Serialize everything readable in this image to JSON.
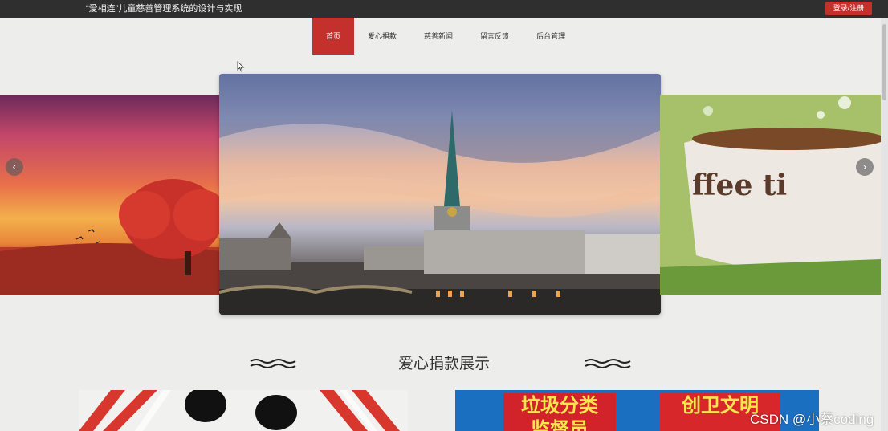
{
  "header": {
    "site_title": "“爱相连”儿童慈善管理系统的设计与实现",
    "login_label": "登录/注册"
  },
  "nav": {
    "items": [
      {
        "label": "首页",
        "active": true
      },
      {
        "label": "爱心捐款",
        "active": false
      },
      {
        "label": "慈善新闻",
        "active": false
      },
      {
        "label": "留言反馈",
        "active": false
      },
      {
        "label": "后台管理",
        "active": false
      }
    ]
  },
  "carousel": {
    "prev_icon": "chevron-left-icon",
    "next_icon": "chevron-right-icon",
    "right_slide_text": "ffee ti"
  },
  "section": {
    "title": "爱心捐款展示"
  },
  "cards": {
    "right_sign_a": "垃圾分类",
    "right_sign_a_line2": "监督员",
    "right_sign_b": "创卫文明"
  },
  "watermark": "CSDN @小蔡coding",
  "colors": {
    "accent": "#c4302b",
    "topbar": "#2f2f2f",
    "page_bg": "#ededec"
  }
}
